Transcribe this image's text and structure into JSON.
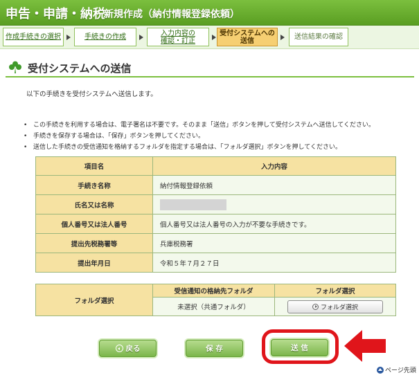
{
  "header": {
    "main_title": "申告・申請・納税",
    "sub_title": "新規作成（納付情報登録依頼）"
  },
  "steps": [
    {
      "label": "作成手続きの選択",
      "state": "done"
    },
    {
      "label": "手続きの作成",
      "state": "done"
    },
    {
      "label": "入力内容の\n確認・訂正",
      "state": "done"
    },
    {
      "label": "受付システムへの\n送信",
      "state": "current"
    },
    {
      "label": "送信結果の確認",
      "state": "future"
    }
  ],
  "section": {
    "title": "受付システムへの送信",
    "lead": "以下の手続きを受付システムへ送信します。"
  },
  "notes": [
    "この手続きを利用する場合は、電子署名は不要です。そのまま「送信」ボタンを押して受付システムへ送信してください。",
    "手続きを保存する場合は、「保存」ボタンを押してください。",
    "送信した手続きの受信通知を格納するフォルダを指定する場合は、「フォルダ選択」ボタンを押してください。"
  ],
  "info_table": {
    "header_item": "項目名",
    "header_value": "入力内容",
    "rows": [
      {
        "label": "手続き名称",
        "value": "納付情報登録依頼"
      },
      {
        "label": "氏名又は名称",
        "value": ""
      },
      {
        "label": "個人番号又は法人番号",
        "value": "個人番号又は法人番号の入力が不要な手続きです。"
      },
      {
        "label": "提出先税務署等",
        "value": "兵庫税務署"
      },
      {
        "label": "提出年月日",
        "value": "令和５年７月２７日"
      }
    ]
  },
  "folder_table": {
    "row_label": "フォルダ選択",
    "col_folder": "受信通知の格納先フォルダ",
    "col_select": "フォルダ選択",
    "folder_value": "未選択（共通フォルダ）",
    "select_button": "フォルダ選択"
  },
  "buttons": {
    "back": "戻る",
    "save": "保 存",
    "send": "送 信"
  },
  "page_top": "ページ先頭",
  "colors": {
    "header_green": "#6aaf30",
    "highlight_red": "#e0151b",
    "table_header": "#f6e2a2",
    "current_step": "#f6cf72"
  }
}
